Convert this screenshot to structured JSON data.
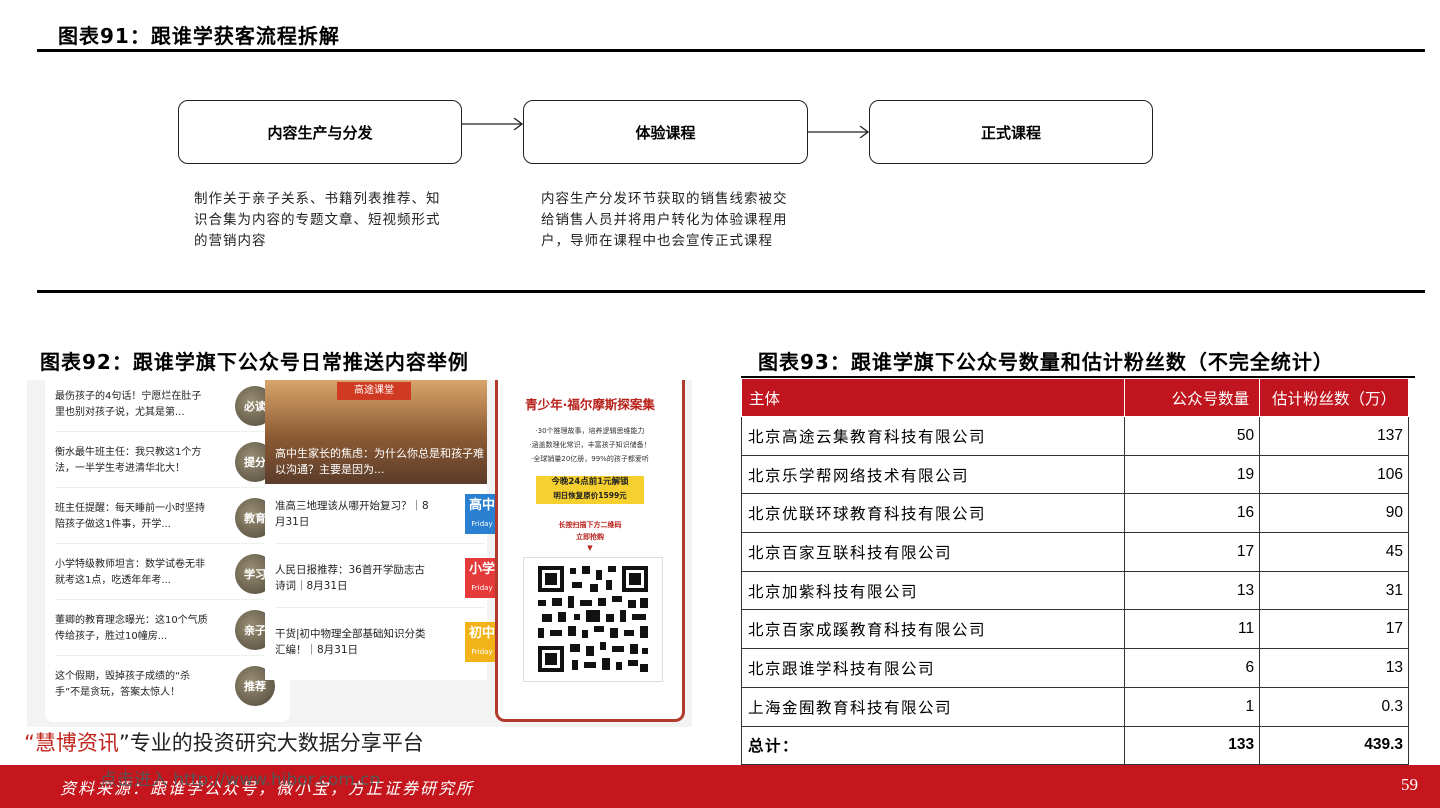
{
  "fig91": {
    "title": "图表91：跟谁学获客流程拆解",
    "steps": [
      {
        "label": "内容生产与分发",
        "desc": "制作关于亲子关系、书籍列表推荐、知识合集为内容的专题文章、短视频形式的营销内容"
      },
      {
        "label": "体验课程",
        "desc": "内容生产分发环节获取的销售线索被交给销售人员并将用户转化为体验课程用户，导师在课程中也会宣传正式课程"
      },
      {
        "label": "正式课程",
        "desc": ""
      }
    ]
  },
  "fig92": {
    "title": "图表92：跟谁学旗下公众号日常推送内容举例",
    "colA": [
      {
        "text": "最伤孩子的4句话！宁愿烂在肚子里也别对孩子说，尤其是第...",
        "thumb": "必读"
      },
      {
        "text": "衡水最牛班主任：我只教这1个方法，一半学生考进清华北大！",
        "thumb": "提分"
      },
      {
        "text": "班主任提醒：每天睡前一小时坚持陪孩子做这1件事，开学...",
        "thumb": "教育"
      },
      {
        "text": "小学特级教师坦言：数学试卷无非就考这1点，吃透年年考...",
        "thumb": "学习"
      },
      {
        "text": "董卿的教育理念曝光：这10个气质传给孩子，胜过10幢房...",
        "thumb": "亲子"
      },
      {
        "text": "这个假期，毁掉孩子成绩的“杀手”不是贪玩，答案太惊人！",
        "thumb": "推荐"
      }
    ],
    "colB": {
      "badge": "高途课堂",
      "hero_caption": "高中生家长的焦虑：为什么你总是和孩子难以沟通？主要是因为...",
      "items": [
        {
          "text": "准高三地理该从哪开始复习？｜8月31日",
          "tag": "高中",
          "day": "Friday",
          "color": "#2a7fd0"
        },
        {
          "text": "人民日报推荐：36首开学励志古诗词｜8月31日",
          "tag": "小学",
          "day": "Friday",
          "color": "#e43a3a"
        },
        {
          "text": "干货|初中物理全部基础知识分类汇编！｜8月31日",
          "tag": "初中",
          "day": "Friday",
          "color": "#f2b318"
        }
      ]
    },
    "colC": {
      "title": "青少年·福尔摩斯探案集",
      "lines": [
        "·30个推理故事，培养逻辑思维能力",
        "·涵盖数理化常识，丰富孩子知识储备！",
        "·全球销量20亿册，99%的孩子都爱听"
      ],
      "promo1": "今晚24点前1元解锁",
      "promo2": "明日恢复原价1599元",
      "scan": "长按扫描下方二维码",
      "buy": "立即抢购",
      "arrow": "▼"
    },
    "watermark_prefix": "“",
    "watermark_brand": "慧博资讯",
    "watermark_rest": "”专业的投资研究大数据分享平台"
  },
  "fig93": {
    "title": "图表93：跟谁学旗下公众号数量和估计粉丝数（不完全统计）",
    "headers": [
      "主体",
      "公众号数量",
      "估计粉丝数（万）"
    ],
    "rows": [
      [
        "北京高途云集教育科技有限公司",
        "50",
        "137"
      ],
      [
        "北京乐学帮网络技术有限公司",
        "19",
        "106"
      ],
      [
        "北京优联环球教育科技有限公司",
        "16",
        "90"
      ],
      [
        "北京百家互联科技有限公司",
        "17",
        "45"
      ],
      [
        "北京加紫科技有限公司",
        "13",
        "31"
      ],
      [
        "北京百家成蹊教育科技有限公司",
        "11",
        "17"
      ],
      [
        "北京跟谁学科技有限公司",
        "6",
        "13"
      ],
      [
        "上海金囿教育科技有限公司",
        "1",
        "0.3"
      ]
    ],
    "total": [
      "总计：",
      "133",
      "439.3"
    ]
  },
  "footer": {
    "source": "资料来源：跟谁学公众号，微小宝，方正证券研究所",
    "link": "点击进入 http://www.hibor.com.cn",
    "page": "59"
  },
  "colors": {
    "accent": "#c5161d"
  }
}
